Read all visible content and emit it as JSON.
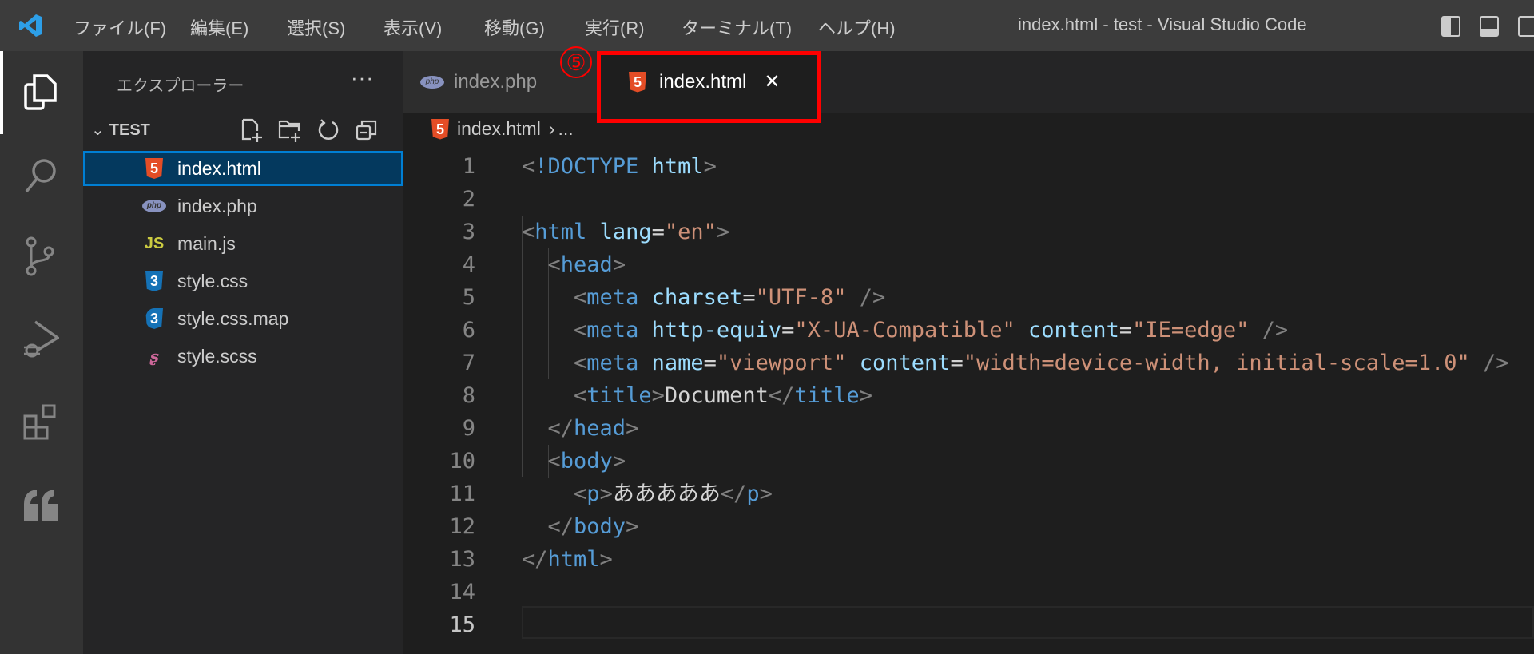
{
  "titlebar": {
    "menus": [
      "ファイル(F)",
      "編集(E)",
      "選択(S)",
      "表示(V)",
      "移動(G)",
      "実行(R)",
      "ターミナル(T)",
      "ヘルプ(H)"
    ],
    "window_title": "index.html - test - Visual Studio Code"
  },
  "sidebar": {
    "title": "エクスプローラー",
    "more": "···",
    "root": "TEST",
    "files": [
      {
        "name": "index.html",
        "icon": "html5-icon",
        "selected": true
      },
      {
        "name": "index.php",
        "icon": "php-icon"
      },
      {
        "name": "main.js",
        "icon": "js-icon"
      },
      {
        "name": "style.css",
        "icon": "css3-icon"
      },
      {
        "name": "style.css.map",
        "icon": "css-map-icon"
      },
      {
        "name": "style.scss",
        "icon": "sass-icon"
      }
    ]
  },
  "tabs": [
    {
      "label": "index.php",
      "active": false
    },
    {
      "label": "index.html",
      "active": true,
      "close": "✕"
    }
  ],
  "annotation": {
    "marker": "⑤",
    "color": "#ff0000"
  },
  "breadcrumb": {
    "file": "index.html",
    "sep": "›",
    "rest": "..."
  },
  "editor": {
    "current_line": 15,
    "line_numbers": [
      "1",
      "2",
      "3",
      "4",
      "5",
      "6",
      "7",
      "8",
      "9",
      "10",
      "11",
      "12",
      "13",
      "14",
      "15"
    ]
  },
  "icons": {
    "html": "5",
    "js": "JS",
    "css": "3",
    "php": "php"
  },
  "colors": {
    "accent": "#007fd4",
    "html": "#e44d26",
    "css": "#1572b6",
    "js": "#cbcb41",
    "sass": "#cd6799"
  }
}
